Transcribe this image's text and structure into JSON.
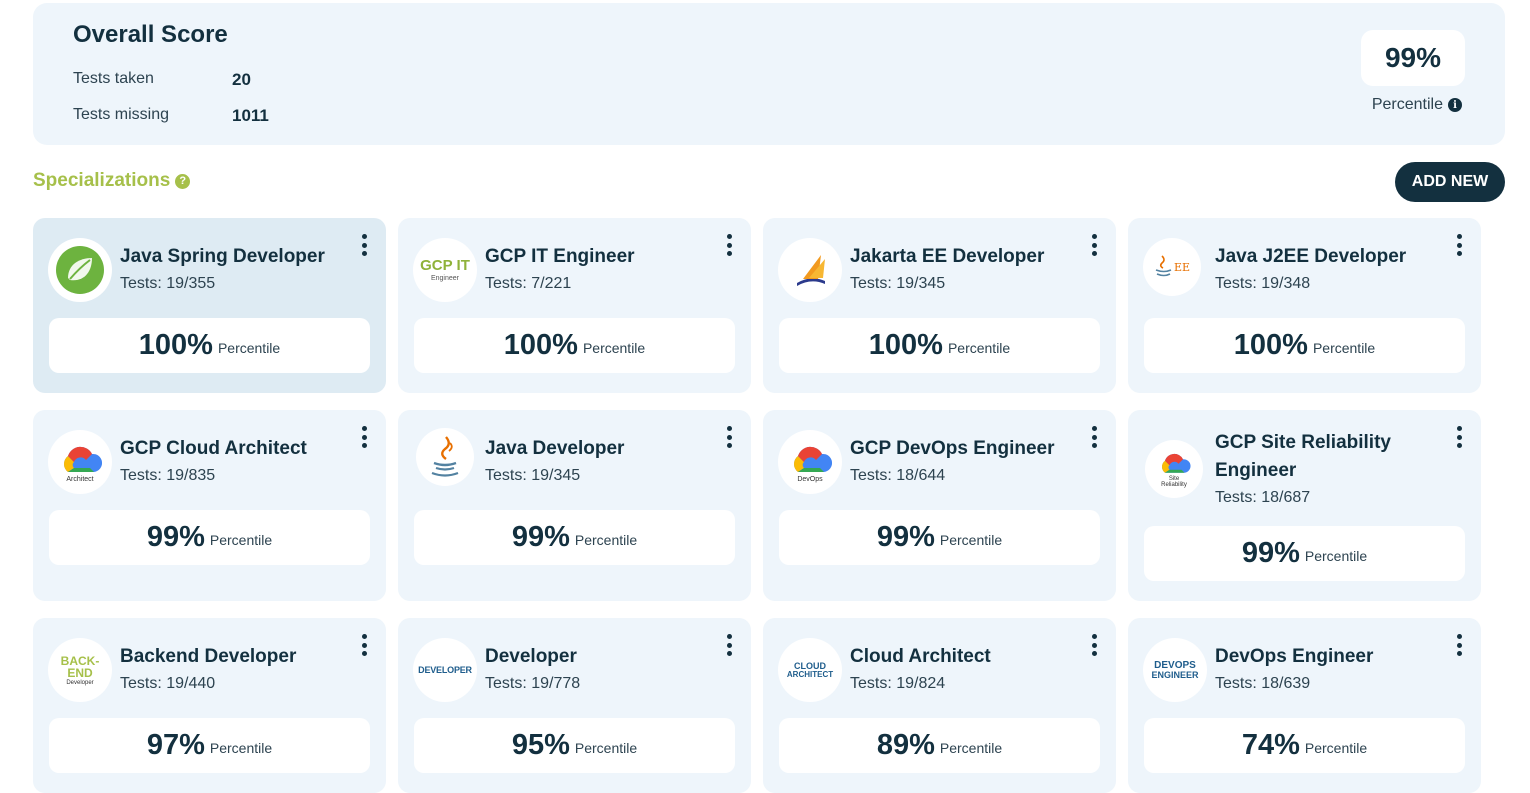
{
  "overall": {
    "title": "Overall Score",
    "tests_taken_label": "Tests taken",
    "tests_taken_value": "20",
    "tests_missing_label": "Tests missing",
    "tests_missing_value": "1011",
    "percentile_value": "99%",
    "percentile_label": "Percentile"
  },
  "specializations": {
    "title": "Specializations",
    "add_new_label": "ADD NEW"
  },
  "percentile_word": "Percentile",
  "cards": [
    {
      "title": "Java Spring Developer",
      "tests": "Tests: 19/355",
      "percentile": "100%",
      "logo": "spring-logo"
    },
    {
      "title": "GCP IT Engineer",
      "tests": "Tests: 7/221",
      "percentile": "100%",
      "logo": "gcp-it-logo",
      "logo_text": "GCP IT",
      "logo_sub": "Engineer"
    },
    {
      "title": "Jakarta EE Developer",
      "tests": "Tests: 19/345",
      "percentile": "100%",
      "logo": "jakarta-logo"
    },
    {
      "title": "Java J2EE Developer",
      "tests": "Tests: 19/348",
      "percentile": "100%",
      "logo": "j2ee-logo",
      "logo_text": "EE"
    },
    {
      "title": "GCP Cloud Architect",
      "tests": "Tests: 19/835",
      "percentile": "99%",
      "logo": "gcp-cloud-logo",
      "logo_sub": "Architect"
    },
    {
      "title": "Java Developer",
      "tests": "Tests: 19/345",
      "percentile": "99%",
      "logo": "java-logo"
    },
    {
      "title": "GCP DevOps Engineer",
      "tests": "Tests: 18/644",
      "percentile": "99%",
      "logo": "gcp-cloud-logo",
      "logo_sub": "DevOps"
    },
    {
      "title": "GCP Site Reliability Engineer",
      "tests": "Tests: 18/687",
      "percentile": "99%",
      "logo": "gcp-cloud-logo",
      "logo_sub": "Site Reliability"
    },
    {
      "title": "Backend Developer",
      "tests": "Tests: 19/440",
      "percentile": "97%",
      "logo": "backend-logo",
      "logo_text": "BACK-",
      "logo_text2": "END",
      "logo_sub": "Developer"
    },
    {
      "title": "Developer",
      "tests": "Tests: 19/778",
      "percentile": "95%",
      "logo": "developer-logo",
      "logo_text": "DEVELOPER"
    },
    {
      "title": "Cloud Architect",
      "tests": "Tests: 19/824",
      "percentile": "89%",
      "logo": "cloud-architect-logo",
      "logo_text": "CLOUD",
      "logo_text2": "ARCHITECT"
    },
    {
      "title": "DevOps Engineer",
      "tests": "Tests: 18/639",
      "percentile": "74%",
      "logo": "devops-logo",
      "logo_text": "DEVOPS",
      "logo_text2": "ENGINEER"
    }
  ],
  "colors": {
    "navy": "#13303f",
    "card_bg": "#eef5fb",
    "card_active_bg": "#deebf3",
    "accent_green": "#a6c04a",
    "spring_green": "#6db33f"
  }
}
